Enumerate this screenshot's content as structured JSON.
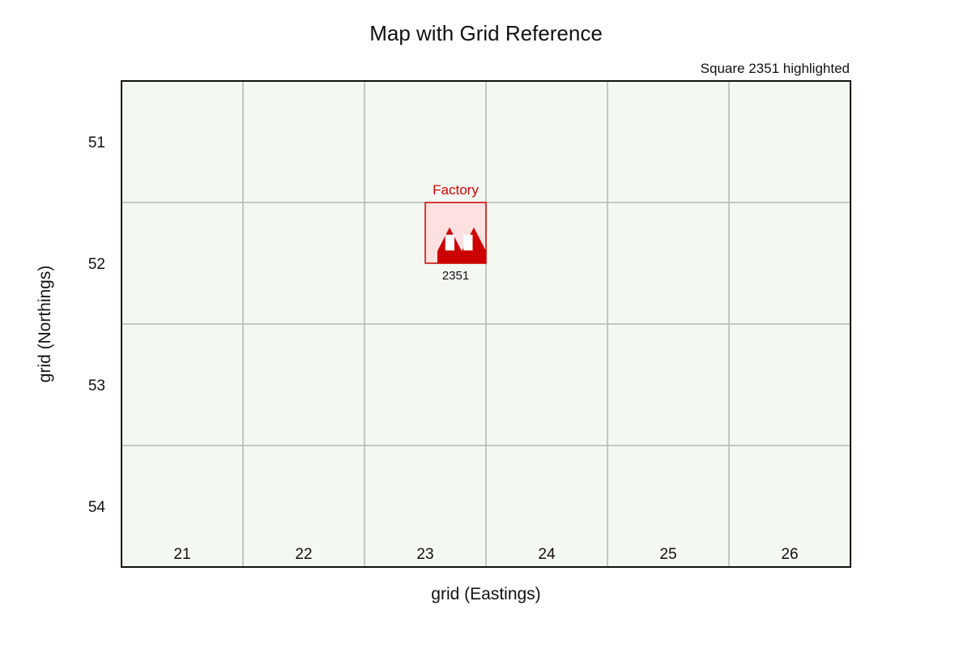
{
  "title": "Map with Grid Reference",
  "note": "Square 2351 highlighted",
  "axes": {
    "x_label": "grid (Eastings)",
    "y_label": "grid (Northings)",
    "eastings": [
      "21",
      "22",
      "23",
      "24",
      "25",
      "26"
    ],
    "northings": [
      "51",
      "52",
      "53",
      "54"
    ]
  },
  "highlight": {
    "easting_from": 23.5,
    "easting_to": 24,
    "northing_from": 52,
    "northing_to": 52.5,
    "label": "Factory",
    "reference": "2351",
    "icon": "factory-icon"
  },
  "colors": {
    "map_background": "#f3f8f1",
    "grid_line": "#b3b8b3",
    "border": "#111111",
    "highlight_fill": "#fde0e0",
    "highlight_stroke": "#cc0000",
    "factory": "#cc0000",
    "window": "#ffffff"
  }
}
